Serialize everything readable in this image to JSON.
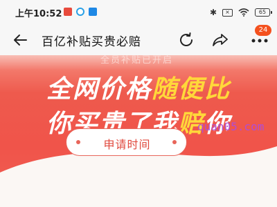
{
  "status_bar": {
    "time": "上午10:52",
    "battery": "65",
    "app_icons": [
      "app-red-icon",
      "app-blue-ring-icon",
      "app-blue-icon"
    ],
    "icons": [
      "bluetooth-icon",
      "sim-no-signal-icon",
      "wifi-icon",
      "battery-icon"
    ]
  },
  "nav": {
    "title": "百亿补贴买贵必赔",
    "badge": "24",
    "icons": [
      "back-arrow-icon",
      "refresh-icon",
      "share-icon",
      "more-icon"
    ]
  },
  "banner": {
    "ghost_text": "全员补贴已开启",
    "line1_white": "全网价格",
    "line1_yellow": "随便比",
    "line2_white": "你买贵了我",
    "line2_yellow": "赔",
    "line2_tail": "你",
    "apply_button": "申请时间",
    "colors": {
      "banner_red": "#f0544a",
      "highlight_yellow": "#ffd83a",
      "badge_orange": "#f4511e"
    }
  },
  "watermark": "quan05.com"
}
